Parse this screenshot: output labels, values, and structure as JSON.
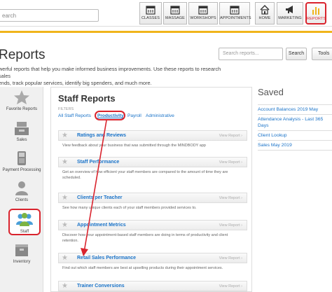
{
  "nav": {
    "search_placeholder": "earch",
    "buttons": [
      {
        "label": "CLASSES",
        "icon": "calendar-icon"
      },
      {
        "label": "MASSAGE",
        "icon": "calendar-icon"
      },
      {
        "label": "WORKSHOPS",
        "icon": "calendar-icon"
      },
      {
        "label": "APPOINTMENTS",
        "icon": "calendar-icon"
      },
      {
        "label": "HOME",
        "icon": "home-icon"
      },
      {
        "label": "MARKETING",
        "icon": "megaphone-icon"
      },
      {
        "label": "REPORTS",
        "icon": "bar-chart-icon"
      }
    ],
    "active_color": "#d9232d",
    "underline_color": "#f0b41c"
  },
  "header": {
    "title": "Reports",
    "search_placeholder": "Search reports...",
    "search_button": "Search",
    "tools_button": "Tools",
    "intro_line1": "werful reports that help you make informed business improvements. Use these reports to research sales",
    "intro_line2": "ends, track popular services, identify big spenders, and much more."
  },
  "categories": [
    {
      "label": "Favorite Reports",
      "icon": "star-icon"
    },
    {
      "label": "Sales",
      "icon": "register-icon"
    },
    {
      "label": "Payment Processing",
      "icon": "card-reader-icon"
    },
    {
      "label": "Clients",
      "icon": "client-icon"
    },
    {
      "label": "Staff",
      "icon": "staff-group-icon"
    },
    {
      "label": "Inventory",
      "icon": "inventory-box-icon"
    }
  ],
  "panel": {
    "title": "Staff Reports",
    "filters_label": "FILTERS",
    "filters": [
      "All Staff Reports",
      "Productivity",
      "Payroll",
      "Administrative"
    ],
    "view_report_label": "View Report",
    "reports": [
      {
        "name": "Ratings and Reviews",
        "desc": "View feedback about your business that was submitted through the MINDBODY app"
      },
      {
        "name": "Staff Performance",
        "desc": "Get an overview of how efficient your staff members are compared to the amount of time they are scheduled."
      },
      {
        "name": "Clients per Teacher",
        "desc": "See how many unique clients each of your staff members provided services to."
      },
      {
        "name": "Appointment Metrics",
        "desc": "Discover how your appointment-based staff members are doing in terms of productivity and client retention."
      },
      {
        "name": "Retail Sales Performance",
        "desc": "Find out which staff members are best at upselling products during their appointment services."
      },
      {
        "name": "Trainer Conversions",
        "desc": ""
      }
    ]
  },
  "saved": {
    "title": "Saved",
    "items": [
      "Account Balances 2019 May",
      "Attendance Analysis - Last 365 Days",
      "Client Lookup",
      "Sales May 2019"
    ]
  }
}
